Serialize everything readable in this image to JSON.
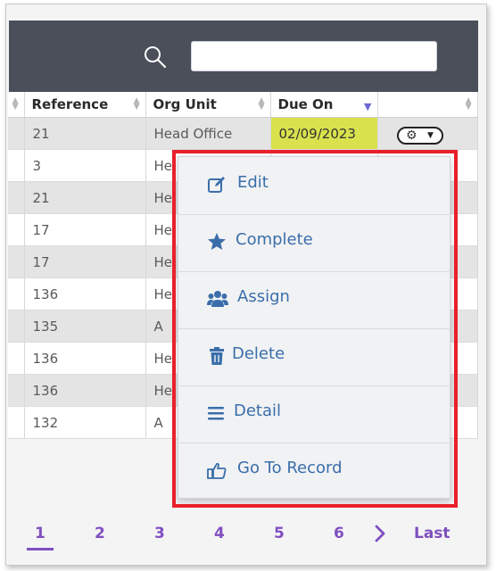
{
  "table": {
    "columns": [
      "",
      "Reference",
      "Org Unit",
      "Due On",
      ""
    ],
    "rows": [
      {
        "reference": "21",
        "org_unit": "Head Office",
        "due_on": "02/09/2023"
      },
      {
        "reference": "3",
        "org_unit": "He",
        "due_on": ""
      },
      {
        "reference": "21",
        "org_unit": "He",
        "due_on": ""
      },
      {
        "reference": "17",
        "org_unit": "He",
        "due_on": ""
      },
      {
        "reference": "17",
        "org_unit": "He",
        "due_on": ""
      },
      {
        "reference": "136",
        "org_unit": "He",
        "due_on": ""
      },
      {
        "reference": "135",
        "org_unit": "A",
        "due_on": ""
      },
      {
        "reference": "136",
        "org_unit": "He",
        "due_on": ""
      },
      {
        "reference": "136",
        "org_unit": "He",
        "due_on": ""
      },
      {
        "reference": "132",
        "org_unit": "A",
        "due_on": ""
      }
    ]
  },
  "row_actions": {
    "gear_icon": "gear-icon",
    "caret_icon": "caret-down-icon"
  },
  "menu": {
    "items": [
      {
        "label": "Edit",
        "icon": "edit-icon"
      },
      {
        "label": "Complete",
        "icon": "star-icon"
      },
      {
        "label": "Assign",
        "icon": "users-icon"
      },
      {
        "label": "Delete",
        "icon": "trash-icon"
      },
      {
        "label": "Detail",
        "icon": "list-icon"
      },
      {
        "label": "Go To Record",
        "icon": "hand-pointer-icon"
      }
    ]
  },
  "pagination": {
    "pages": [
      "1",
      "2",
      "3",
      "4",
      "5",
      "6"
    ],
    "active": "1",
    "next_icon": "chevron-right-icon",
    "last_label": "Last"
  },
  "colors": {
    "header_bar": "#4a4f5a",
    "menu_text": "#3a6eaa",
    "due_highlight": "#d9e24c",
    "highlight_border": "#e8202a",
    "pager_accent": "#7f4fbf"
  }
}
